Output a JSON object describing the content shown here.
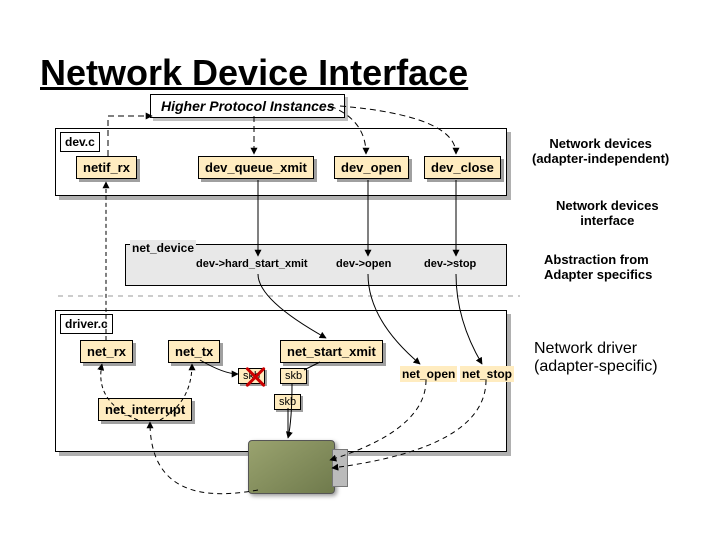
{
  "title": "Network Device Interface",
  "higher_box": "Higher Protocol Instances",
  "dev_c": {
    "label": "dev.c",
    "fns": {
      "netif_rx": "netif_rx",
      "dev_queue_xmit": "dev_queue_xmit",
      "dev_open": "dev_open",
      "dev_close": "dev_close"
    }
  },
  "net_device": {
    "label": "net_device",
    "ptrs": {
      "hard_start_xmit": "dev->hard_start_xmit",
      "open": "dev->open",
      "stop": "dev->stop"
    }
  },
  "driver_c": {
    "label": "driver.c",
    "fns": {
      "net_rx": "net_rx",
      "net_tx": "net_tx",
      "net_start_xmit": "net_start_xmit",
      "net_open": "net_open",
      "net_stop": "net_stop",
      "net_interrupt": "net_interrupt"
    },
    "skb": {
      "a1": "skb",
      "a2": "skb",
      "b": "skb"
    }
  },
  "labels": {
    "adapter_independent": "Network devices\n(adapter-independent)",
    "interface": "Network devices\ninterface",
    "abstraction": "Abstraction from\nAdapter specifics",
    "adapter_specific": "Network driver\n(adapter-specific)"
  },
  "chart_data": {
    "type": "diagram",
    "nodes": [
      {
        "id": "higher",
        "label": "Higher Protocol Instances",
        "group": "upper"
      },
      {
        "id": "netif_rx",
        "label": "netif_rx",
        "group": "dev.c"
      },
      {
        "id": "dev_queue_xmit",
        "label": "dev_queue_xmit",
        "group": "dev.c"
      },
      {
        "id": "dev_open",
        "label": "dev_open",
        "group": "dev.c"
      },
      {
        "id": "dev_close",
        "label": "dev_close",
        "group": "dev.c"
      },
      {
        "id": "net_device",
        "label": "net_device",
        "group": "interface"
      },
      {
        "id": "hard_start_xmit",
        "label": "dev->hard_start_xmit",
        "group": "net_device"
      },
      {
        "id": "open_ptr",
        "label": "dev->open",
        "group": "net_device"
      },
      {
        "id": "stop_ptr",
        "label": "dev->stop",
        "group": "net_device"
      },
      {
        "id": "net_rx",
        "label": "net_rx",
        "group": "driver.c"
      },
      {
        "id": "net_tx",
        "label": "net_tx",
        "group": "driver.c"
      },
      {
        "id": "net_start_xmit",
        "label": "net_start_xmit",
        "group": "driver.c"
      },
      {
        "id": "net_open",
        "label": "net_open",
        "group": "driver.c"
      },
      {
        "id": "net_stop",
        "label": "net_stop",
        "group": "driver.c"
      },
      {
        "id": "net_interrupt",
        "label": "net_interrupt",
        "group": "driver.c"
      },
      {
        "id": "nic",
        "label": "NIC hardware",
        "group": "hardware"
      }
    ],
    "edges": [
      {
        "from": "netif_rx",
        "to": "higher",
        "style": "dashed-up"
      },
      {
        "from": "higher",
        "to": "dev_queue_xmit",
        "style": "dashed-down"
      },
      {
        "from": "higher",
        "to": "dev_open",
        "style": "dashed-down"
      },
      {
        "from": "higher",
        "to": "dev_close",
        "style": "dashed-down"
      },
      {
        "from": "dev_queue_xmit",
        "to": "hard_start_xmit"
      },
      {
        "from": "dev_open",
        "to": "open_ptr"
      },
      {
        "from": "dev_close",
        "to": "stop_ptr"
      },
      {
        "from": "hard_start_xmit",
        "to": "net_start_xmit"
      },
      {
        "from": "open_ptr",
        "to": "net_open"
      },
      {
        "from": "stop_ptr",
        "to": "net_stop"
      },
      {
        "from": "nic",
        "to": "net_interrupt",
        "style": "dashed"
      },
      {
        "from": "net_interrupt",
        "to": "net_rx"
      },
      {
        "from": "net_interrupt",
        "to": "net_tx"
      },
      {
        "from": "net_rx",
        "to": "netif_rx",
        "label": "skb"
      },
      {
        "from": "net_tx",
        "to": "skb",
        "label": "skb",
        "status": "freed"
      },
      {
        "from": "net_start_xmit",
        "to": "nic",
        "label": "skb"
      }
    ],
    "annotations": [
      "Network devices (adapter-independent)",
      "Network devices interface",
      "Abstraction from Adapter specifics",
      "Network driver (adapter-specific)"
    ]
  }
}
